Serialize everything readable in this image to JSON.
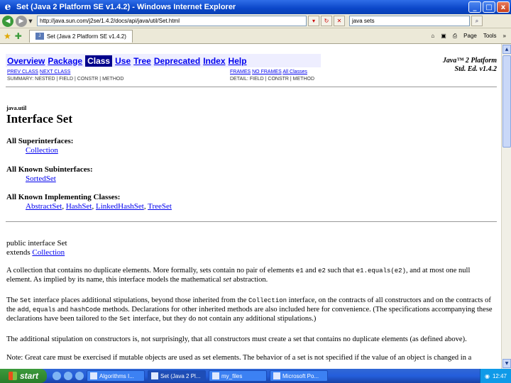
{
  "window": {
    "title": "Set (Java 2 Platform SE v1.4.2) - Windows Internet Explorer",
    "minimize": "_",
    "maximize": "□",
    "close": "x"
  },
  "address": {
    "url": "http://java.sun.com/j2se/1.4.2/docs/api/java/util/Set.html",
    "search_value": "java sets"
  },
  "favbar": {
    "tab_title": "Set (Java 2 Platform SE v1.4.2)",
    "page_menu": "Page",
    "tools_menu": "Tools",
    "more": "»"
  },
  "doc_nav": {
    "items": [
      {
        "label": "Overview"
      },
      {
        "label": "Package"
      },
      {
        "label": "Class"
      },
      {
        "label": "Use"
      },
      {
        "label": "Tree"
      },
      {
        "label": "Deprecated"
      },
      {
        "label": "Index"
      },
      {
        "label": "Help"
      }
    ],
    "platform_line1": "Java™ 2 Platform",
    "platform_line2": "Std. Ed. v1.4.2",
    "prev_class": "PREV CLASS",
    "next_class": "NEXT CLASS",
    "frames": "FRAMES",
    "no_frames": "NO FRAMES",
    "all_classes": "All Classes",
    "summary_line": "SUMMARY: NESTED | FIELD | CONSTR | METHOD",
    "detail_line": "DETAIL: FIELD | CONSTR | METHOD"
  },
  "doc": {
    "package": "java.util",
    "title": "Interface Set",
    "superinterfaces_label": "All Superinterfaces:",
    "superinterfaces": [
      "Collection"
    ],
    "subinterfaces_label": "All Known Subinterfaces:",
    "subinterfaces": [
      "SortedSet"
    ],
    "implementing_label": "All Known Implementing Classes:",
    "implementing": [
      "AbstractSet",
      "HashSet",
      "LinkedHashSet",
      "TreeSet"
    ],
    "decl_line1": "public interface Set",
    "decl_extends": "extends",
    "decl_parent": "Collection",
    "p1_a": "A collection that contains no duplicate elements. More formally, sets contain no pair of elements",
    "p1_e1": "e1",
    "p1_and": "and",
    "p1_e2": "e2",
    "p1_such": "such that",
    "p1_eq": "e1.equals(e2)",
    "p1_b": ", and at most one null element. As implied by its name, this interface models the mathematical",
    "p1_set": "set",
    "p1_c": "abstraction.",
    "p2_a": "The",
    "p2_set": "Set",
    "p2_b": "interface places additional stipulations, beyond those inherited from the",
    "p2_coll": "Collection",
    "p2_c": "interface, on the contracts of all constructors and on the contracts of the",
    "p2_add": "add",
    "p2_comma": ",",
    "p2_equals": "equals",
    "p2_and": "and",
    "p2_hash": "hashCode",
    "p2_d": "methods. Declarations for other inherited methods are also included here for convenience. (The specifications accompanying these declarations have been tailored to the",
    "p2_set2": "Set",
    "p2_e": "interface, but they do not contain any additional stipulations.)",
    "p3": "The additional stipulation on constructors is, not surprisingly, that all constructors must create a set that contains no duplicate elements (as defined above).",
    "p4": "Note: Great care must be exercised if mutable objects are used as set elements. The behavior of a set is not specified if the value of an object is changed in a"
  },
  "taskbar": {
    "start": "start",
    "tasks": [
      "Algorithms I...",
      "Set (Java 2 Pl...",
      "my_files",
      "Microsoft Po..."
    ],
    "clock": "12:47"
  }
}
